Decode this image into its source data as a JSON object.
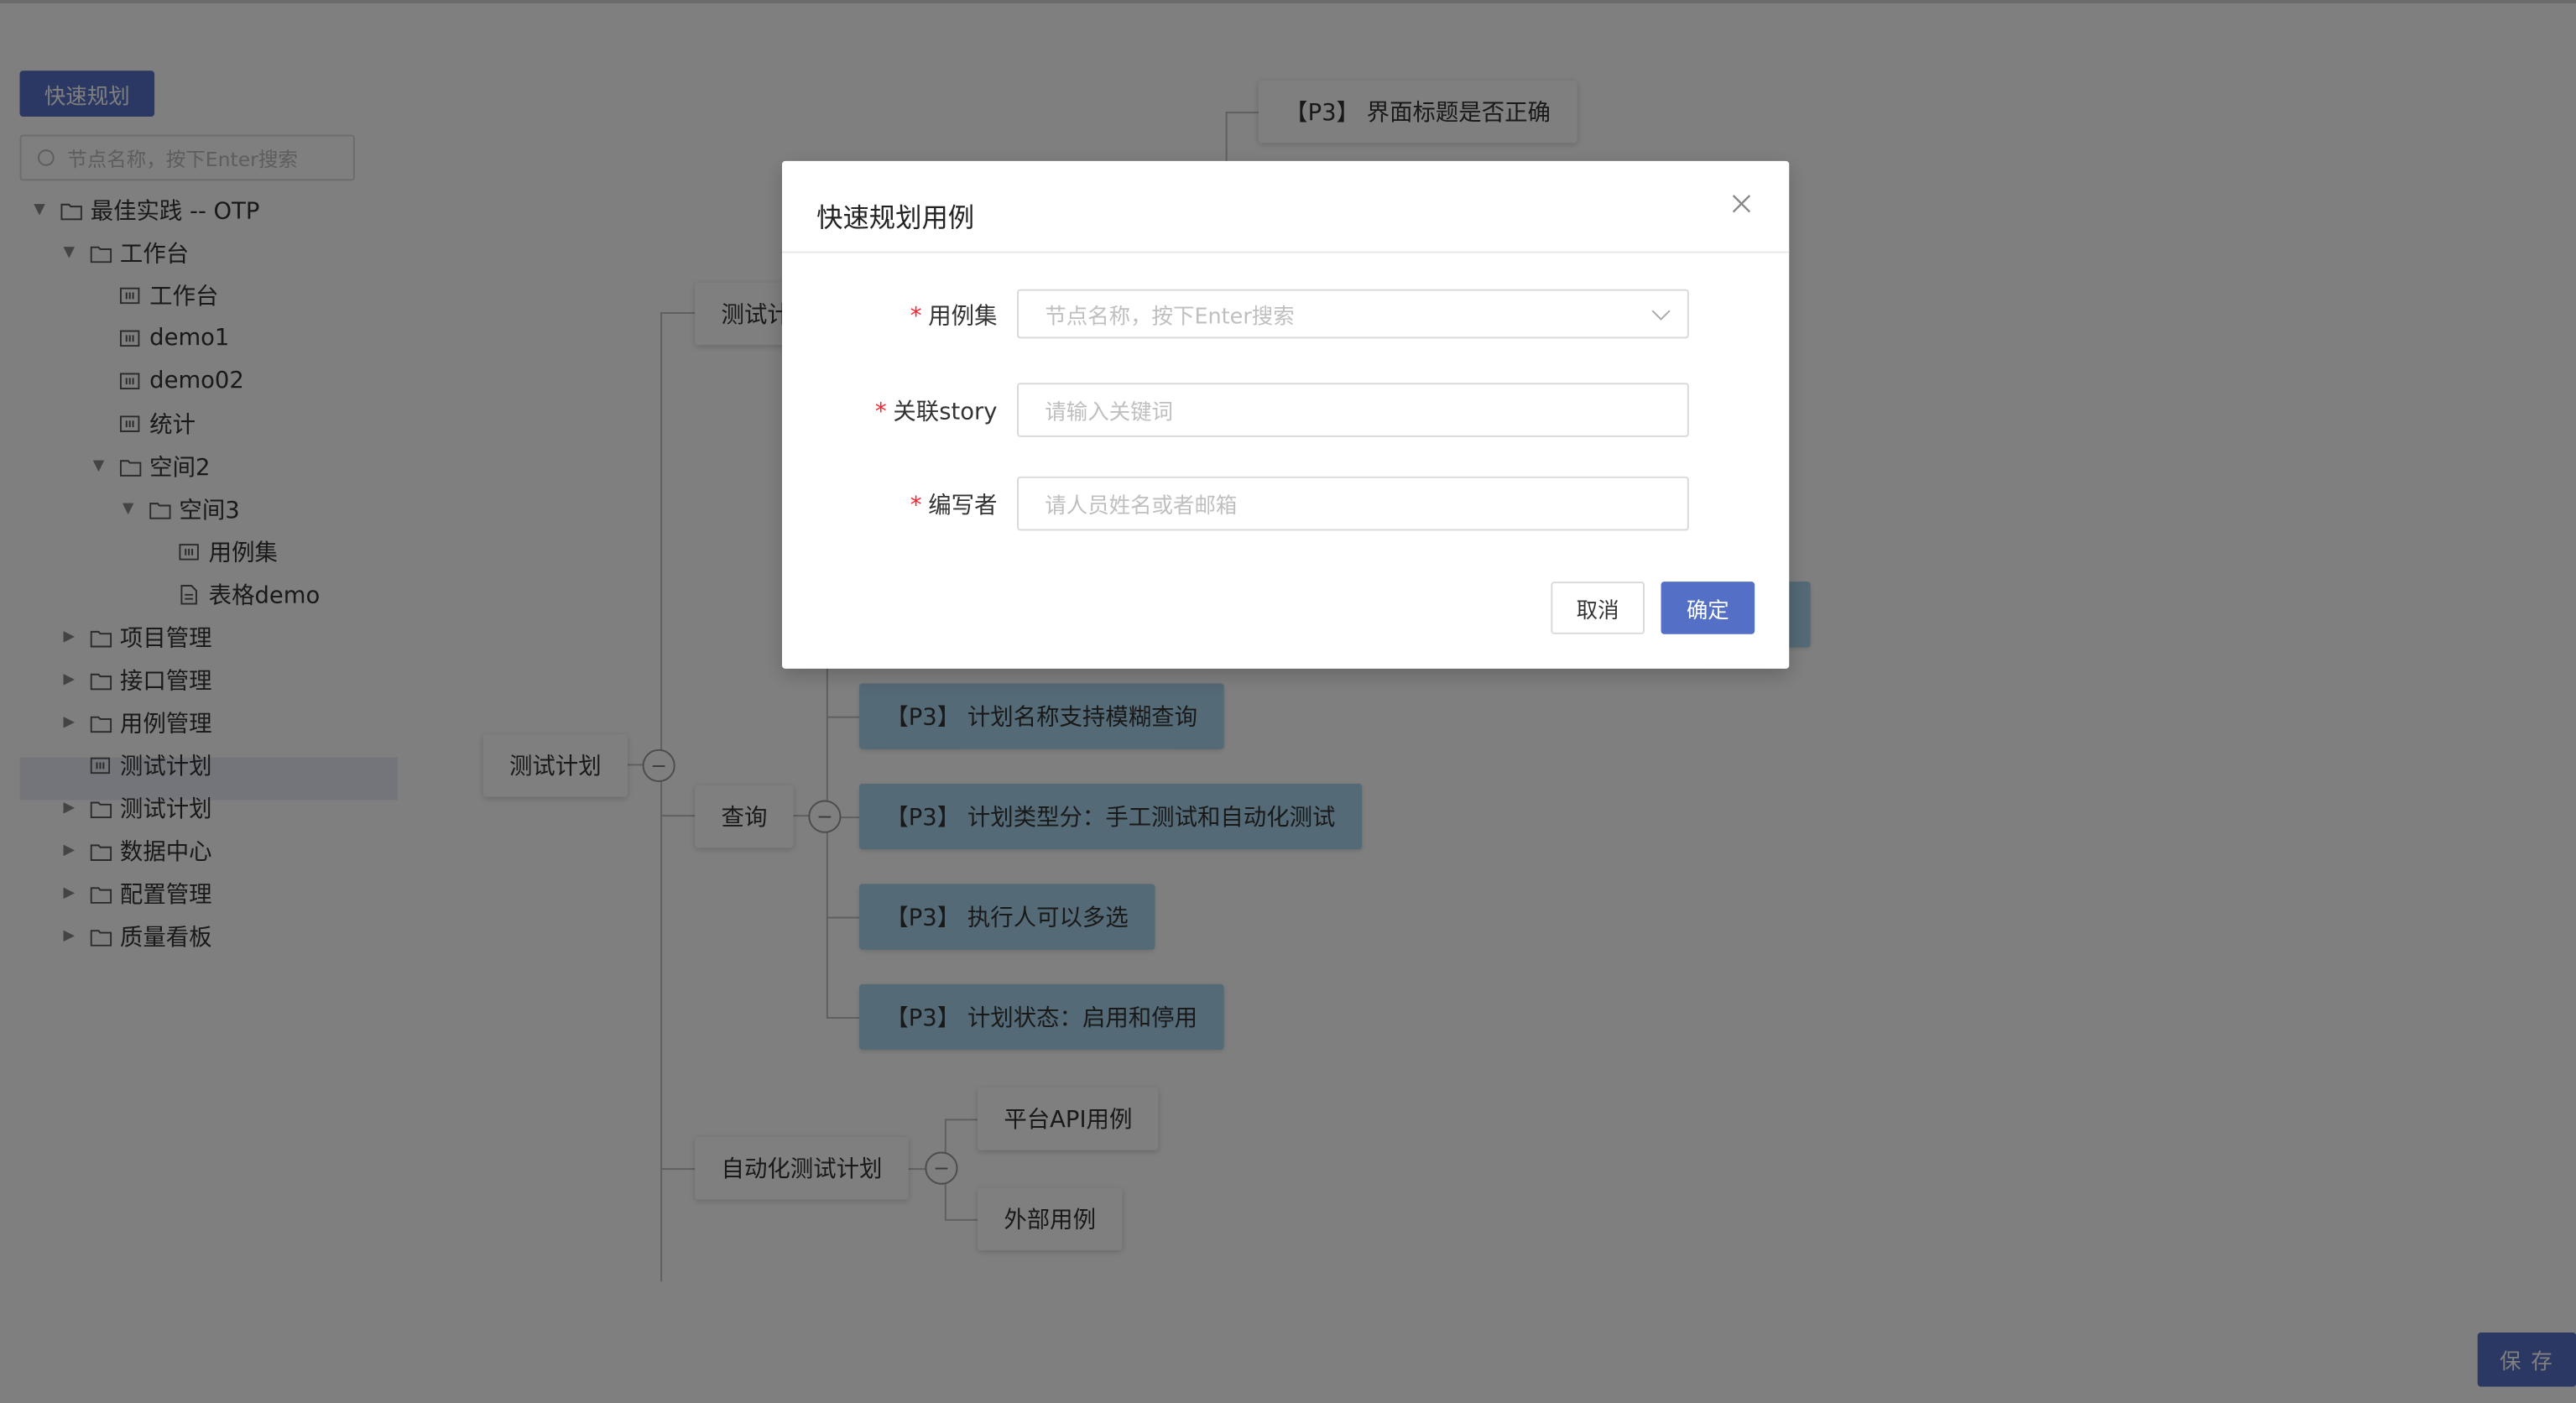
{
  "toolbar": {
    "quick_plan_label": "快速规划",
    "save_label": "保 存"
  },
  "search": {
    "placeholder": "节点名称，按下Enter搜索"
  },
  "tree": {
    "items": [
      {
        "label": "最佳实践 -- OTP",
        "icon": "folder-icon",
        "expanded": true
      },
      {
        "label": "工作台",
        "icon": "folder-icon",
        "expanded": true
      },
      {
        "label": "工作台",
        "icon": "module-icon"
      },
      {
        "label": "demo1",
        "icon": "module-icon"
      },
      {
        "label": "demo02",
        "icon": "module-icon"
      },
      {
        "label": "统计",
        "icon": "module-icon"
      },
      {
        "label": "空间2",
        "icon": "folder-icon",
        "expanded": true
      },
      {
        "label": "空间3",
        "icon": "folder-icon",
        "expanded": true
      },
      {
        "label": "用例集",
        "icon": "module-icon"
      },
      {
        "label": "表格demo",
        "icon": "document-icon"
      },
      {
        "label": "项目管理",
        "icon": "folder-icon"
      },
      {
        "label": "接口管理",
        "icon": "folder-icon"
      },
      {
        "label": "用例管理",
        "icon": "folder-icon"
      },
      {
        "label": "测试计划",
        "icon": "module-icon",
        "selected": true
      },
      {
        "label": "测试计划",
        "icon": "folder-icon"
      },
      {
        "label": "数据中心",
        "icon": "folder-icon"
      },
      {
        "label": "配置管理",
        "icon": "folder-icon"
      },
      {
        "label": "质量看板",
        "icon": "folder-icon"
      }
    ]
  },
  "mindmap": {
    "root": "测试计划",
    "top_branch": "测试计",
    "top_leaf": "【P3】 界面标题是否正确",
    "query_node": "查询",
    "query_leaves": [
      "【P3】 计划名称支持模糊查询",
      "【P3】 计划类型分：手工测试和自动化测试",
      "【P3】 执行人可以多选",
      "【P3】 计划状态：启用和停用"
    ],
    "auto_node": "自动化测试计划",
    "auto_leaves": [
      "平台API用例",
      "外部用例"
    ],
    "collapse_symbol": "−"
  },
  "modal": {
    "title": "快速规划用例",
    "required_mark": "*",
    "fields": [
      {
        "label": "用例集",
        "placeholder": "节点名称，按下Enter搜索",
        "type": "select"
      },
      {
        "label": "关联story",
        "placeholder": "请输入关键词",
        "type": "text"
      },
      {
        "label": "编写者",
        "placeholder": "请人员姓名或者邮箱",
        "type": "text"
      }
    ],
    "cancel_label": "取消",
    "ok_label": "确定"
  },
  "colors": {
    "primary": "#5470c6",
    "leaf_blue": "#a8d4ec",
    "required": "#f5222d"
  }
}
